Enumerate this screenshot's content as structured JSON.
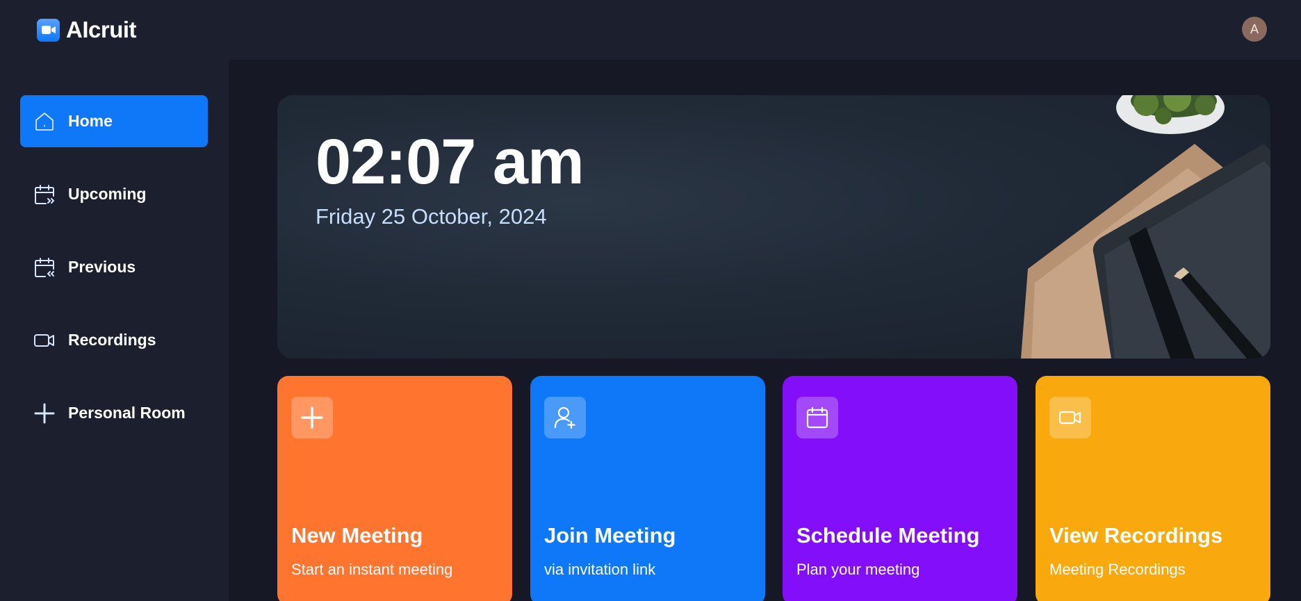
{
  "app": {
    "name": "AIcruit",
    "avatar_initial": "A"
  },
  "colors": {
    "accent": "#0e78f9",
    "background": "#1c1f2e",
    "main_background": "#161925",
    "card_orange": "#ff742e",
    "card_blue": "#0e78f9",
    "card_purple": "#830ef9",
    "card_yellow": "#f9a90e"
  },
  "sidebar": {
    "items": [
      {
        "label": "Home",
        "icon": "home-icon",
        "active": true
      },
      {
        "label": "Upcoming",
        "icon": "calendar-forward-icon",
        "active": false
      },
      {
        "label": "Previous",
        "icon": "calendar-back-icon",
        "active": false
      },
      {
        "label": "Recordings",
        "icon": "video-icon",
        "active": false
      },
      {
        "label": "Personal Room",
        "icon": "plus-icon",
        "active": false
      }
    ]
  },
  "hero": {
    "time": "02:07 am",
    "date": "Friday 25 October, 2024"
  },
  "cards": [
    {
      "title": "New Meeting",
      "subtitle": "Start an instant meeting",
      "icon": "plus-icon",
      "color": "#ff742e"
    },
    {
      "title": "Join Meeting",
      "subtitle": "via invitation link",
      "icon": "user-add-icon",
      "color": "#0e78f9"
    },
    {
      "title": "Schedule Meeting",
      "subtitle": "Plan your meeting",
      "icon": "calendar-icon",
      "color": "#830ef9"
    },
    {
      "title": "View Recordings",
      "subtitle": "Meeting Recordings",
      "icon": "video-icon",
      "color": "#f9a90e"
    }
  ]
}
